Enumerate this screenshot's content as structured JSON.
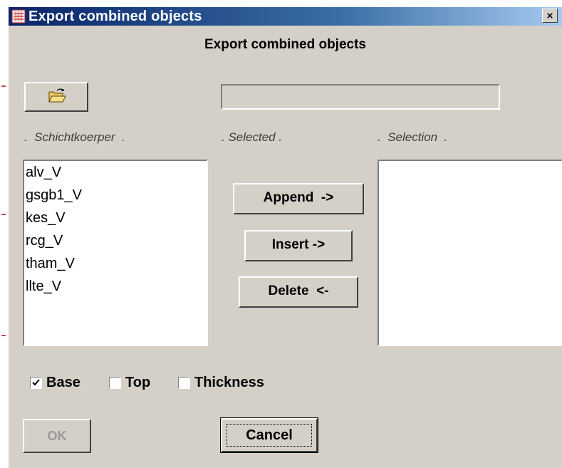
{
  "window": {
    "title": "Export combined objects",
    "close_glyph": "×"
  },
  "dialog": {
    "heading": "Export combined objects",
    "folder_icon": "open-folder-icon",
    "path_value": ""
  },
  "columns": {
    "left_label": ".  Schichtkoerper  .",
    "middle_label": ". Selected .",
    "right_label": ".  Selection  ."
  },
  "left_list": {
    "items": [
      "alv_V",
      "gsgb1_V",
      "kes_V",
      "rcg_V",
      "tham_V",
      "llte_V"
    ]
  },
  "right_list": {
    "items": []
  },
  "buttons": {
    "append": "Append  ->",
    "insert": "Insert ->",
    "delete": "Delete  <-",
    "ok": "OK",
    "cancel": "Cancel"
  },
  "checkboxes": [
    {
      "label": "Base",
      "checked": true
    },
    {
      "label": "Top",
      "checked": false
    },
    {
      "label": "Thickness",
      "checked": false
    }
  ],
  "colors": {
    "dialog_bg": "#d4d0c8",
    "title_bar_start": "#0a246a",
    "title_bar_end": "#a6caf0"
  }
}
